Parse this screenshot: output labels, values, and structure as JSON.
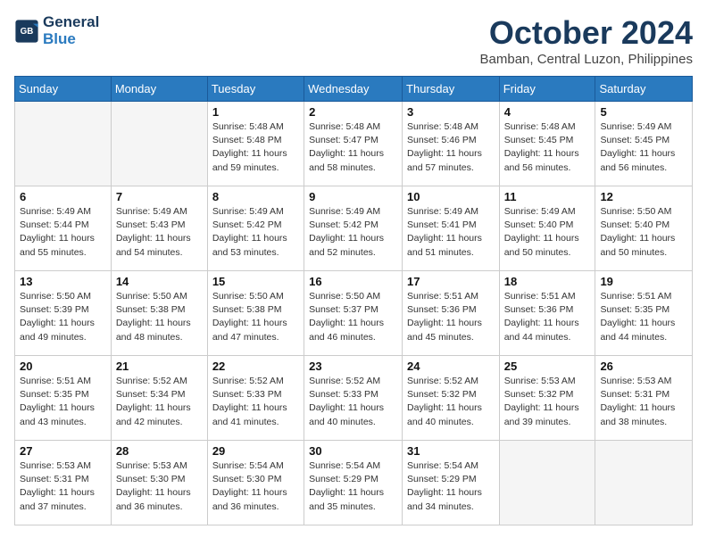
{
  "header": {
    "logo_line1": "General",
    "logo_line2": "Blue",
    "month": "October 2024",
    "location": "Bamban, Central Luzon, Philippines"
  },
  "days_of_week": [
    "Sunday",
    "Monday",
    "Tuesday",
    "Wednesday",
    "Thursday",
    "Friday",
    "Saturday"
  ],
  "weeks": [
    [
      {
        "day": "",
        "empty": true
      },
      {
        "day": "",
        "empty": true
      },
      {
        "day": "1",
        "sunrise": "5:48 AM",
        "sunset": "5:48 PM",
        "daylight": "11 hours and 59 minutes."
      },
      {
        "day": "2",
        "sunrise": "5:48 AM",
        "sunset": "5:47 PM",
        "daylight": "11 hours and 58 minutes."
      },
      {
        "day": "3",
        "sunrise": "5:48 AM",
        "sunset": "5:46 PM",
        "daylight": "11 hours and 57 minutes."
      },
      {
        "day": "4",
        "sunrise": "5:48 AM",
        "sunset": "5:45 PM",
        "daylight": "11 hours and 56 minutes."
      },
      {
        "day": "5",
        "sunrise": "5:49 AM",
        "sunset": "5:45 PM",
        "daylight": "11 hours and 56 minutes."
      }
    ],
    [
      {
        "day": "6",
        "sunrise": "5:49 AM",
        "sunset": "5:44 PM",
        "daylight": "11 hours and 55 minutes."
      },
      {
        "day": "7",
        "sunrise": "5:49 AM",
        "sunset": "5:43 PM",
        "daylight": "11 hours and 54 minutes."
      },
      {
        "day": "8",
        "sunrise": "5:49 AM",
        "sunset": "5:42 PM",
        "daylight": "11 hours and 53 minutes."
      },
      {
        "day": "9",
        "sunrise": "5:49 AM",
        "sunset": "5:42 PM",
        "daylight": "11 hours and 52 minutes."
      },
      {
        "day": "10",
        "sunrise": "5:49 AM",
        "sunset": "5:41 PM",
        "daylight": "11 hours and 51 minutes."
      },
      {
        "day": "11",
        "sunrise": "5:49 AM",
        "sunset": "5:40 PM",
        "daylight": "11 hours and 50 minutes."
      },
      {
        "day": "12",
        "sunrise": "5:50 AM",
        "sunset": "5:40 PM",
        "daylight": "11 hours and 50 minutes."
      }
    ],
    [
      {
        "day": "13",
        "sunrise": "5:50 AM",
        "sunset": "5:39 PM",
        "daylight": "11 hours and 49 minutes."
      },
      {
        "day": "14",
        "sunrise": "5:50 AM",
        "sunset": "5:38 PM",
        "daylight": "11 hours and 48 minutes."
      },
      {
        "day": "15",
        "sunrise": "5:50 AM",
        "sunset": "5:38 PM",
        "daylight": "11 hours and 47 minutes."
      },
      {
        "day": "16",
        "sunrise": "5:50 AM",
        "sunset": "5:37 PM",
        "daylight": "11 hours and 46 minutes."
      },
      {
        "day": "17",
        "sunrise": "5:51 AM",
        "sunset": "5:36 PM",
        "daylight": "11 hours and 45 minutes."
      },
      {
        "day": "18",
        "sunrise": "5:51 AM",
        "sunset": "5:36 PM",
        "daylight": "11 hours and 44 minutes."
      },
      {
        "day": "19",
        "sunrise": "5:51 AM",
        "sunset": "5:35 PM",
        "daylight": "11 hours and 44 minutes."
      }
    ],
    [
      {
        "day": "20",
        "sunrise": "5:51 AM",
        "sunset": "5:35 PM",
        "daylight": "11 hours and 43 minutes."
      },
      {
        "day": "21",
        "sunrise": "5:52 AM",
        "sunset": "5:34 PM",
        "daylight": "11 hours and 42 minutes."
      },
      {
        "day": "22",
        "sunrise": "5:52 AM",
        "sunset": "5:33 PM",
        "daylight": "11 hours and 41 minutes."
      },
      {
        "day": "23",
        "sunrise": "5:52 AM",
        "sunset": "5:33 PM",
        "daylight": "11 hours and 40 minutes."
      },
      {
        "day": "24",
        "sunrise": "5:52 AM",
        "sunset": "5:32 PM",
        "daylight": "11 hours and 40 minutes."
      },
      {
        "day": "25",
        "sunrise": "5:53 AM",
        "sunset": "5:32 PM",
        "daylight": "11 hours and 39 minutes."
      },
      {
        "day": "26",
        "sunrise": "5:53 AM",
        "sunset": "5:31 PM",
        "daylight": "11 hours and 38 minutes."
      }
    ],
    [
      {
        "day": "27",
        "sunrise": "5:53 AM",
        "sunset": "5:31 PM",
        "daylight": "11 hours and 37 minutes."
      },
      {
        "day": "28",
        "sunrise": "5:53 AM",
        "sunset": "5:30 PM",
        "daylight": "11 hours and 36 minutes."
      },
      {
        "day": "29",
        "sunrise": "5:54 AM",
        "sunset": "5:30 PM",
        "daylight": "11 hours and 36 minutes."
      },
      {
        "day": "30",
        "sunrise": "5:54 AM",
        "sunset": "5:29 PM",
        "daylight": "11 hours and 35 minutes."
      },
      {
        "day": "31",
        "sunrise": "5:54 AM",
        "sunset": "5:29 PM",
        "daylight": "11 hours and 34 minutes."
      },
      {
        "day": "",
        "empty": true
      },
      {
        "day": "",
        "empty": true
      }
    ]
  ]
}
